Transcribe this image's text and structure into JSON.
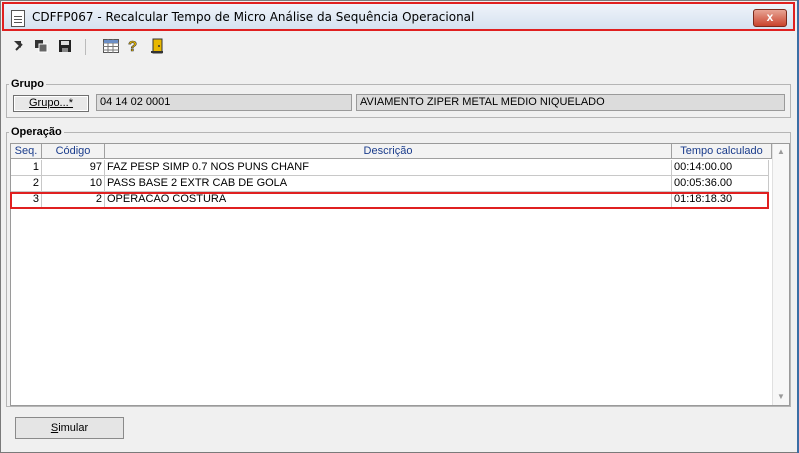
{
  "window": {
    "title": "CDFFP067 - Recalcular Tempo de Micro Análise da Sequência Operacional",
    "close_label": "x"
  },
  "toolbar": {
    "items": [
      {
        "name": "arrow-out-icon"
      },
      {
        "name": "copy-icon"
      },
      {
        "name": "save-icon"
      },
      {
        "name": "grid-icon"
      },
      {
        "name": "help-icon"
      },
      {
        "name": "exit-door-icon"
      }
    ]
  },
  "grupo": {
    "legend": "Grupo",
    "button_label": "Grupo...*",
    "code": "04 14 02 0001",
    "description": "AVIAMENTO ZIPER METAL MEDIO NIQUELADO"
  },
  "operacao": {
    "legend": "Operação",
    "columns": [
      "Seq.",
      "Código",
      "Descrição",
      "Tempo calculado"
    ],
    "rows": [
      {
        "seq": "1",
        "codigo": "97",
        "descricao": "FAZ PESP SIMP 0.7 NOS PUNS CHANF",
        "tempo": "00:14:00.00"
      },
      {
        "seq": "2",
        "codigo": "10",
        "descricao": "PASS BASE 2 EXTR CAB DE GOLA",
        "tempo": "00:05:36.00"
      },
      {
        "seq": "3",
        "codigo": "2",
        "descricao": "OPERACAO COSTURA",
        "tempo": "01:18:18.30"
      }
    ]
  },
  "footer": {
    "simular_label": "imular",
    "simular_mnemonic": "S"
  },
  "colors": {
    "highlight": "#e02020",
    "header_text": "#1a3c8c",
    "desktop": "#3a6ea5"
  }
}
